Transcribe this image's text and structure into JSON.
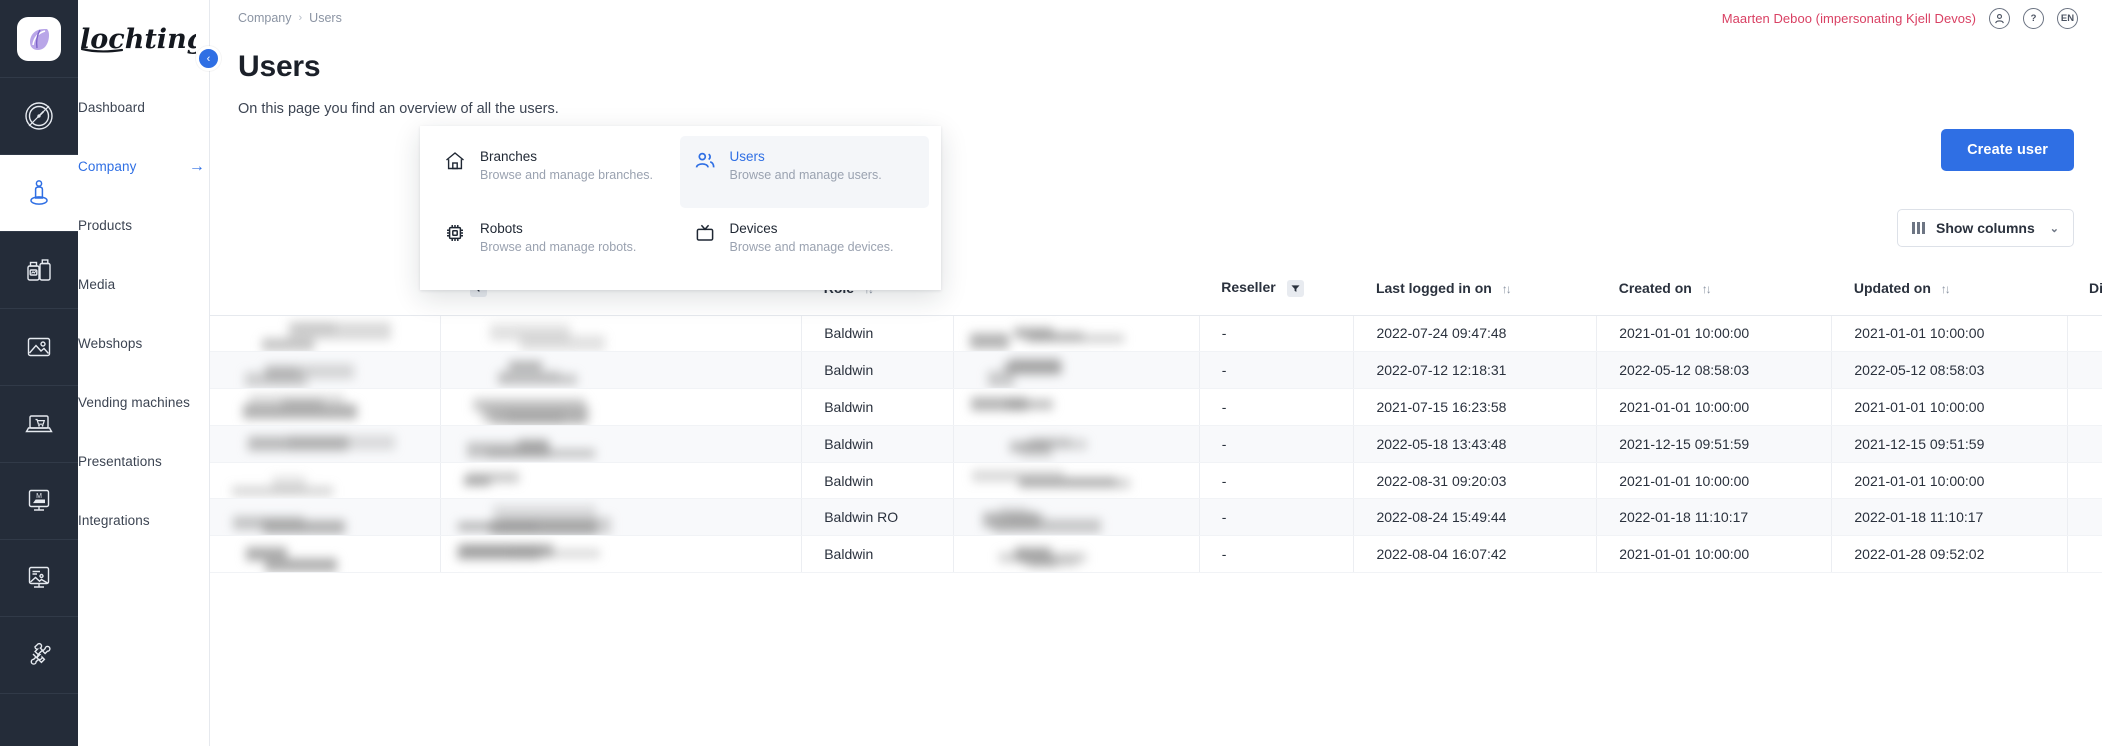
{
  "rail": {
    "logo_name": "lochting-app-tile",
    "items": [
      {
        "name": "dashboard",
        "icon": "speedometer-icon"
      },
      {
        "name": "company",
        "icon": "person-location-icon",
        "active": true
      },
      {
        "name": "products",
        "icon": "bottles-icon"
      },
      {
        "name": "media",
        "icon": "image-icon"
      },
      {
        "name": "webshops",
        "icon": "laptop-cart-icon"
      },
      {
        "name": "vending-machines",
        "icon": "vending-screen-icon"
      },
      {
        "name": "presentations",
        "icon": "presentation-screen-icon"
      },
      {
        "name": "integrations",
        "icon": "puzzle-icon"
      }
    ]
  },
  "sidebar": {
    "brand": "lochting",
    "collapse_label": "‹",
    "items": [
      {
        "label": "Dashboard",
        "active": false
      },
      {
        "label": "Company",
        "active": true,
        "arrow": "→"
      },
      {
        "label": "Products",
        "active": false
      },
      {
        "label": "Media",
        "active": false
      },
      {
        "label": "Webshops",
        "active": false
      },
      {
        "label": "Vending machines",
        "active": false
      },
      {
        "label": "Presentations",
        "active": false
      },
      {
        "label": "Integrations",
        "active": false
      }
    ]
  },
  "topbar": {
    "breadcrumb": {
      "parent": "Company",
      "separator": "›",
      "current": "Users"
    },
    "impersonation": "Maarten Deboo (impersonating Kjell Devos)",
    "help_label": "?",
    "language": "EN"
  },
  "page": {
    "title": "Users",
    "subtitle": "On this page you find an overview of all the users.",
    "create_button": "Create user",
    "show_columns": "Show columns",
    "show_columns_chevron": "⌄"
  },
  "mega_menu": {
    "items": [
      {
        "title": "Branches",
        "desc": "Browse and manage branches.",
        "icon": "home-icon",
        "selected": false
      },
      {
        "title": "Users",
        "desc": "Browse and manage users.",
        "icon": "users-icon",
        "selected": true
      },
      {
        "title": "Robots",
        "desc": "Browse and manage robots.",
        "icon": "chip-icon",
        "selected": false
      },
      {
        "title": "Devices",
        "desc": "Browse and manage devices.",
        "icon": "tv-icon",
        "selected": false
      }
    ]
  },
  "table": {
    "columns": [
      {
        "label": "",
        "sort": false,
        "filter": false,
        "kind": "blur-a"
      },
      {
        "label": "",
        "sort": false,
        "filter": true,
        "kind": "blur-b"
      },
      {
        "label": "Role",
        "sort": true,
        "filter": false,
        "kind": "role"
      },
      {
        "label": "",
        "sort": false,
        "filter": false,
        "kind": "blur-c"
      },
      {
        "label": "Reseller",
        "sort": false,
        "filter": true,
        "kind": "reseller"
      },
      {
        "label": "Last logged in on",
        "sort": true,
        "filter": false,
        "kind": "last_login"
      },
      {
        "label": "Created on",
        "sort": true,
        "filter": false,
        "kind": "created"
      },
      {
        "label": "Updated on",
        "sort": true,
        "filter": false,
        "kind": "updated"
      },
      {
        "label": "Disabled",
        "sort": false,
        "filter": false,
        "kind": "disabled"
      }
    ],
    "sort_glyph": "↑↓",
    "filter_glyph": "▼",
    "eye_glyph": "◉",
    "rows": [
      {
        "role": "Baldwin",
        "reseller": "-",
        "last_login": "2022-07-24 09:47:48",
        "created": "2021-01-01 10:00:00",
        "updated": "2021-01-01 10:00:00"
      },
      {
        "role": "Baldwin",
        "reseller": "-",
        "last_login": "2022-07-12 12:18:31",
        "created": "2022-05-12 08:58:03",
        "updated": "2022-05-12 08:58:03"
      },
      {
        "role": "Baldwin",
        "reseller": "-",
        "last_login": "2021-07-15 16:23:58",
        "created": "2021-01-01 10:00:00",
        "updated": "2021-01-01 10:00:00"
      },
      {
        "role": "Baldwin",
        "reseller": "-",
        "last_login": "2022-05-18 13:43:48",
        "created": "2021-12-15 09:51:59",
        "updated": "2021-12-15 09:51:59"
      },
      {
        "role": "Baldwin",
        "reseller": "-",
        "last_login": "2022-08-31 09:20:03",
        "created": "2021-01-01 10:00:00",
        "updated": "2021-01-01 10:00:00"
      },
      {
        "role": "Baldwin RO",
        "reseller": "-",
        "last_login": "2022-08-24 15:49:44",
        "created": "2022-01-18 11:10:17",
        "updated": "2022-01-18 11:10:17"
      },
      {
        "role": "Baldwin",
        "reseller": "-",
        "last_login": "2022-08-04 16:07:42",
        "created": "2021-01-01 10:00:00",
        "updated": "2022-01-28 09:52:02"
      }
    ]
  },
  "colors": {
    "accent": "#2f6fe4",
    "rail_bg": "#242c39",
    "impersonation": "#d94063",
    "row_alt": "#f8f9fb"
  }
}
